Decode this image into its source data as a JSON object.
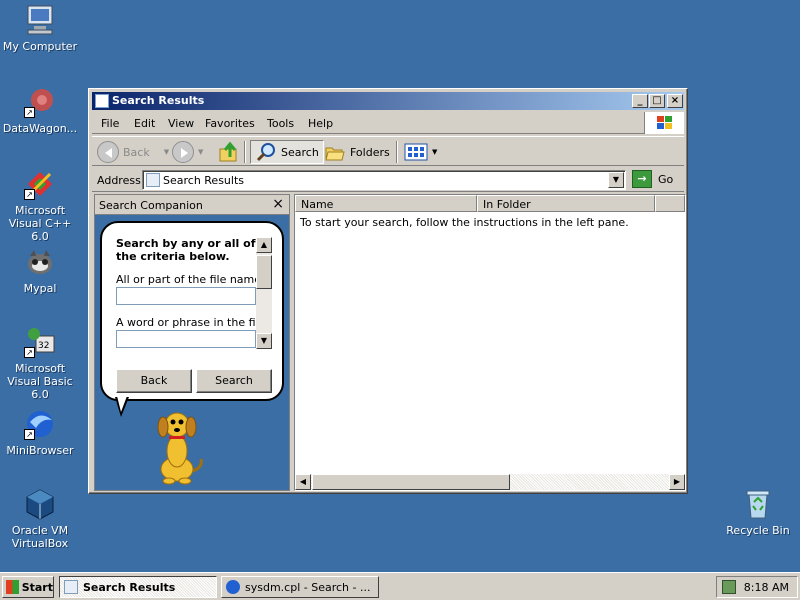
{
  "desktop": {
    "icons": [
      {
        "label": "My Computer",
        "icon": "my-computer-icon"
      },
      {
        "label": "DataWagon...",
        "icon": "datawagon-icon"
      },
      {
        "label": "Microsoft Visual C++ 6.0",
        "icon": "visual-cpp-icon"
      },
      {
        "label": "Mypal",
        "icon": "mypal-icon"
      },
      {
        "label": "Microsoft Visual Basic 6.0",
        "icon": "visual-basic-icon"
      },
      {
        "label": "MiniBrowser",
        "icon": "minibrowser-icon"
      },
      {
        "label": "Oracle VM VirtualBox",
        "icon": "virtualbox-icon"
      },
      {
        "label": "Recycle Bin",
        "icon": "recycle-bin-icon"
      }
    ]
  },
  "window": {
    "title": "Search Results",
    "menu": [
      "File",
      "Edit",
      "View",
      "Favorites",
      "Tools",
      "Help"
    ],
    "toolbar": {
      "back": "Back",
      "search": "Search",
      "folders": "Folders"
    },
    "address": {
      "label": "Address",
      "value": "Search Results",
      "go": "Go"
    },
    "companion": {
      "header": "Search Companion",
      "close": "×",
      "heading": "Search by any or all of the criteria below.",
      "file_name_label": "All or part of the file name:",
      "phrase_label": "A word or phrase in the file:",
      "back_button": "Back",
      "search_button": "Search"
    },
    "results": {
      "columns": [
        "Name",
        "In Folder"
      ],
      "message": "To start your search, follow the instructions in the left pane."
    }
  },
  "taskbar": {
    "start": "Start",
    "tasks": [
      "Search Results",
      "sysdm.cpl - Search - ..."
    ],
    "clock": "8:18 AM"
  },
  "colors": {
    "desktop": "#3a6ea5",
    "titlebar_start": "#0a246a",
    "titlebar_end": "#a6caf0"
  }
}
